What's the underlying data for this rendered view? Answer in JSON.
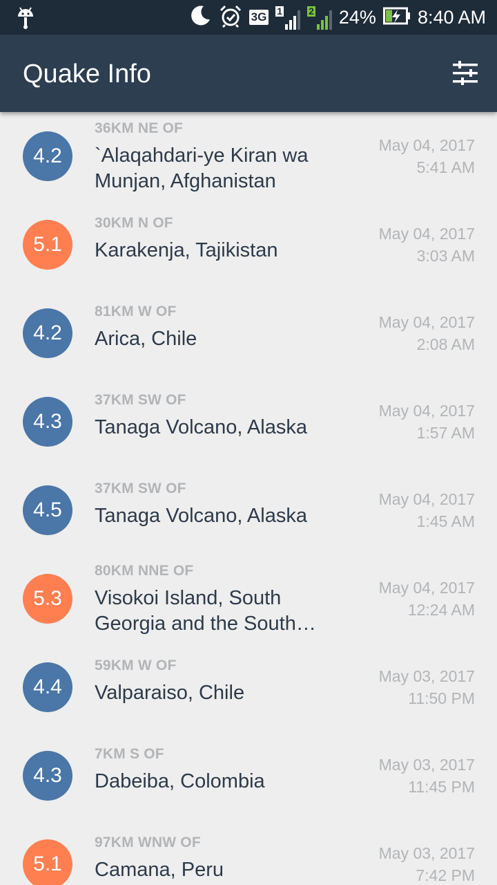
{
  "status_bar": {
    "network": "3G",
    "sim1": "1",
    "sim2": "2",
    "battery_percent": "24%",
    "time": "8:40 AM",
    "icons": [
      "android-debug-icon",
      "moon-icon",
      "alarm-icon",
      "battery-charging-icon"
    ]
  },
  "app_bar": {
    "title": "Quake Info",
    "filter_icon": "sliders-icon"
  },
  "colors": {
    "status_bar_bg": "#1e2b38",
    "app_bar_bg": "#2c3e50",
    "magnitude_low": "#4a76a8",
    "magnitude_high": "#ff7f50",
    "list_bg": "#eeeeee"
  },
  "quakes": [
    {
      "mag": "4.2",
      "level": "low",
      "offset": "36KM NE OF",
      "place": " `Alaqahdari-ye Kiran wa Munjan, Afghanistan",
      "date": "May 04, 2017",
      "time": "5:41 AM"
    },
    {
      "mag": "5.1",
      "level": "high",
      "offset": "30KM N OF",
      "place": " Karakenja, Tajikistan",
      "date": "May 04, 2017",
      "time": "3:03 AM"
    },
    {
      "mag": "4.2",
      "level": "low",
      "offset": "81KM W OF",
      "place": " Arica, Chile",
      "date": "May 04, 2017",
      "time": "2:08 AM"
    },
    {
      "mag": "4.3",
      "level": "low",
      "offset": "37KM SW OF",
      "place": " Tanaga Volcano, Alaska",
      "date": "May 04, 2017",
      "time": "1:57 AM"
    },
    {
      "mag": "4.5",
      "level": "low",
      "offset": "37KM SW OF",
      "place": " Tanaga Volcano, Alaska",
      "date": "May 04, 2017",
      "time": "1:45 AM"
    },
    {
      "mag": "5.3",
      "level": "high",
      "offset": "80KM NNE OF",
      "place": " Visokoi Island, South Georgia and the South…",
      "date": "May 04, 2017",
      "time": "12:24 AM"
    },
    {
      "mag": "4.4",
      "level": "low",
      "offset": "59KM W OF",
      "place": " Valparaiso, Chile",
      "date": "May 03, 2017",
      "time": "11:50 PM"
    },
    {
      "mag": "4.3",
      "level": "low",
      "offset": "7KM S OF",
      "place": " Dabeiba, Colombia",
      "date": "May 03, 2017",
      "time": "11:45 PM"
    },
    {
      "mag": "5.1",
      "level": "high",
      "offset": "97KM WNW OF",
      "place": " Camana, Peru",
      "date": "May 03, 2017",
      "time": "7:42 PM"
    }
  ]
}
